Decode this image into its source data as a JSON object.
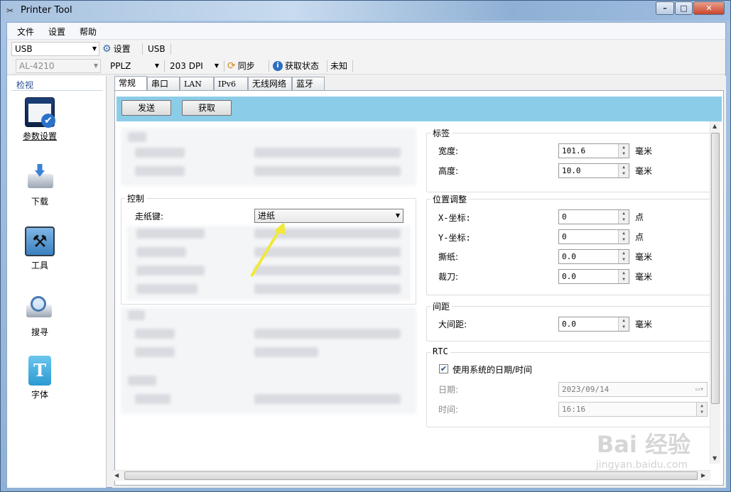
{
  "window": {
    "title": "Printer Tool",
    "min": "–",
    "max": "□",
    "close": "✕"
  },
  "menu": [
    "文件",
    "设置",
    "帮助"
  ],
  "toolbar1": {
    "port": "USB",
    "settings": "设置",
    "port_label": "USB"
  },
  "toolbar2": {
    "model": "AL-4210",
    "language": "PPLZ",
    "dpi": "203 DPI",
    "sync": "同步",
    "get_status": "获取状态",
    "status_value": "未知"
  },
  "sidebar": {
    "header": "检视",
    "items": [
      {
        "label": "参数设置",
        "icon": "settings-panel-icon"
      },
      {
        "label": "下载",
        "icon": "download-printer-icon"
      },
      {
        "label": "工具",
        "icon": "tools-icon"
      },
      {
        "label": "搜寻",
        "icon": "search-printer-icon"
      },
      {
        "label": "字体",
        "icon": "font-icon"
      }
    ]
  },
  "tabs": [
    "常规",
    "串口",
    "LAN",
    "IPv6",
    "无线网络",
    "蓝牙"
  ],
  "actions": {
    "send": "发送",
    "get": "获取"
  },
  "control": {
    "title": "控制",
    "feed_key_label": "走纸键:",
    "feed_key_value": "进纸"
  },
  "label_group": {
    "title": "标签",
    "width_label": "宽度:",
    "width_value": "101.6",
    "width_unit": "毫米",
    "height_label": "高度:",
    "height_value": "10.0",
    "height_unit": "毫米"
  },
  "position_group": {
    "title": "位置调整",
    "x_label": "X-坐标:",
    "x_value": "0",
    "x_unit": "点",
    "y_label": "Y-坐标:",
    "y_value": "0",
    "y_unit": "点",
    "tear_label": "撕纸:",
    "tear_value": "0.0",
    "tear_unit": "毫米",
    "cutter_label": "裁刀:",
    "cutter_value": "0.0",
    "cutter_unit": "毫米"
  },
  "gap_group": {
    "title": "间距",
    "gap_label": "大间距:",
    "gap_value": "0.0",
    "gap_unit": "毫米"
  },
  "rtc_group": {
    "title": "RTC",
    "use_system_label": "使用系统的日期/时间",
    "use_system_checked": true,
    "date_label": "日期:",
    "date_value": "2023/09/14",
    "time_label": "时间:",
    "time_value": "16:16"
  },
  "watermark": {
    "brand": "Bai 经验",
    "url": "jingyan.baidu.com"
  },
  "colors": {
    "accent_bar": "#8bcde8",
    "annotation_arrow": "#f2e83a"
  }
}
